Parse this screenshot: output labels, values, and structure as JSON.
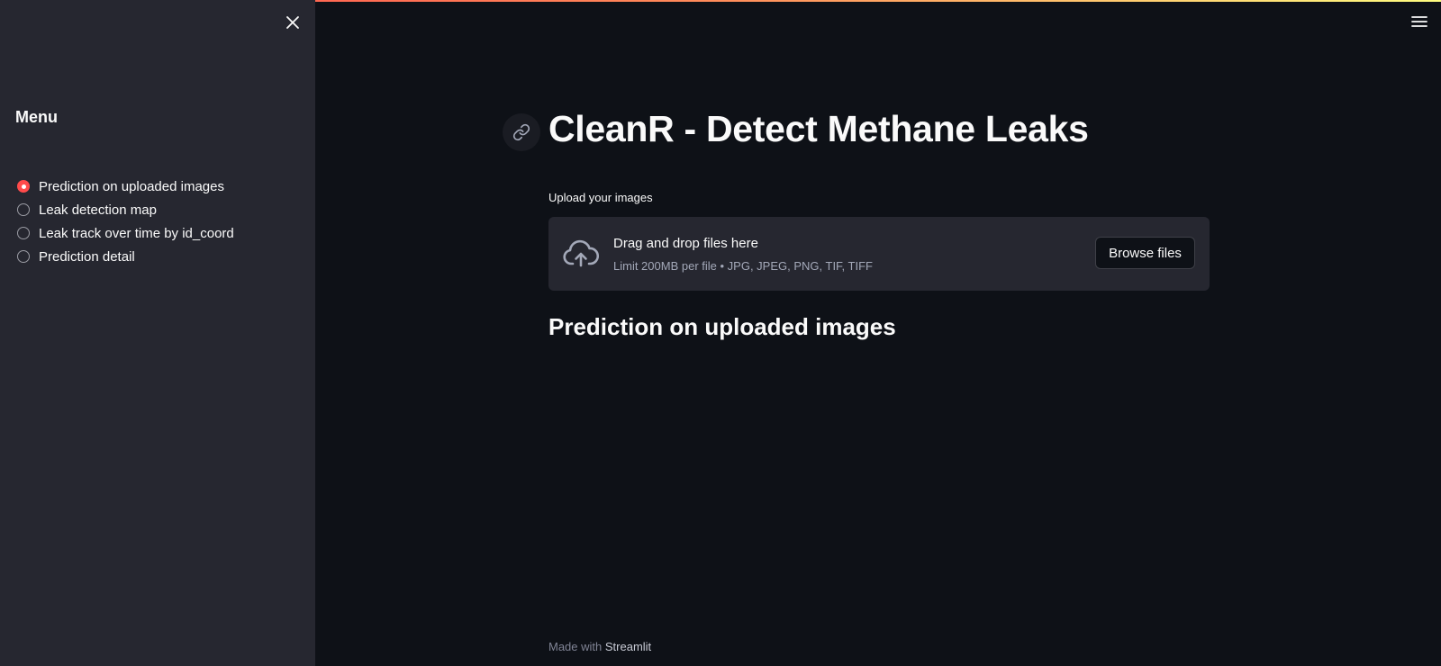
{
  "sidebar": {
    "title": "Menu",
    "options": [
      {
        "label": "Prediction on uploaded images",
        "selected": true
      },
      {
        "label": "Leak detection map",
        "selected": false
      },
      {
        "label": "Leak track over time by id_coord",
        "selected": false
      },
      {
        "label": "Prediction detail",
        "selected": false
      }
    ],
    "close_icon": "close-icon"
  },
  "header": {
    "menu_icon": "hamburger-menu-icon"
  },
  "main": {
    "title": "CleanR - Detect Methane Leaks",
    "anchor_icon": "link-icon",
    "uploader": {
      "label": "Upload your images",
      "drop_text": "Drag and drop files here",
      "limit_text": "Limit 200MB per file • JPG, JPEG, PNG, TIF, TIFF",
      "browse_label": "Browse files",
      "icon": "cloud-upload-icon"
    },
    "section_heading": "Prediction on uploaded images"
  },
  "footer": {
    "prefix": "Made with",
    "brand": "Streamlit"
  },
  "colors": {
    "background": "#0e1117",
    "sidebar": "#262730",
    "accent": "#ff4b4b",
    "text": "#fafafa"
  }
}
